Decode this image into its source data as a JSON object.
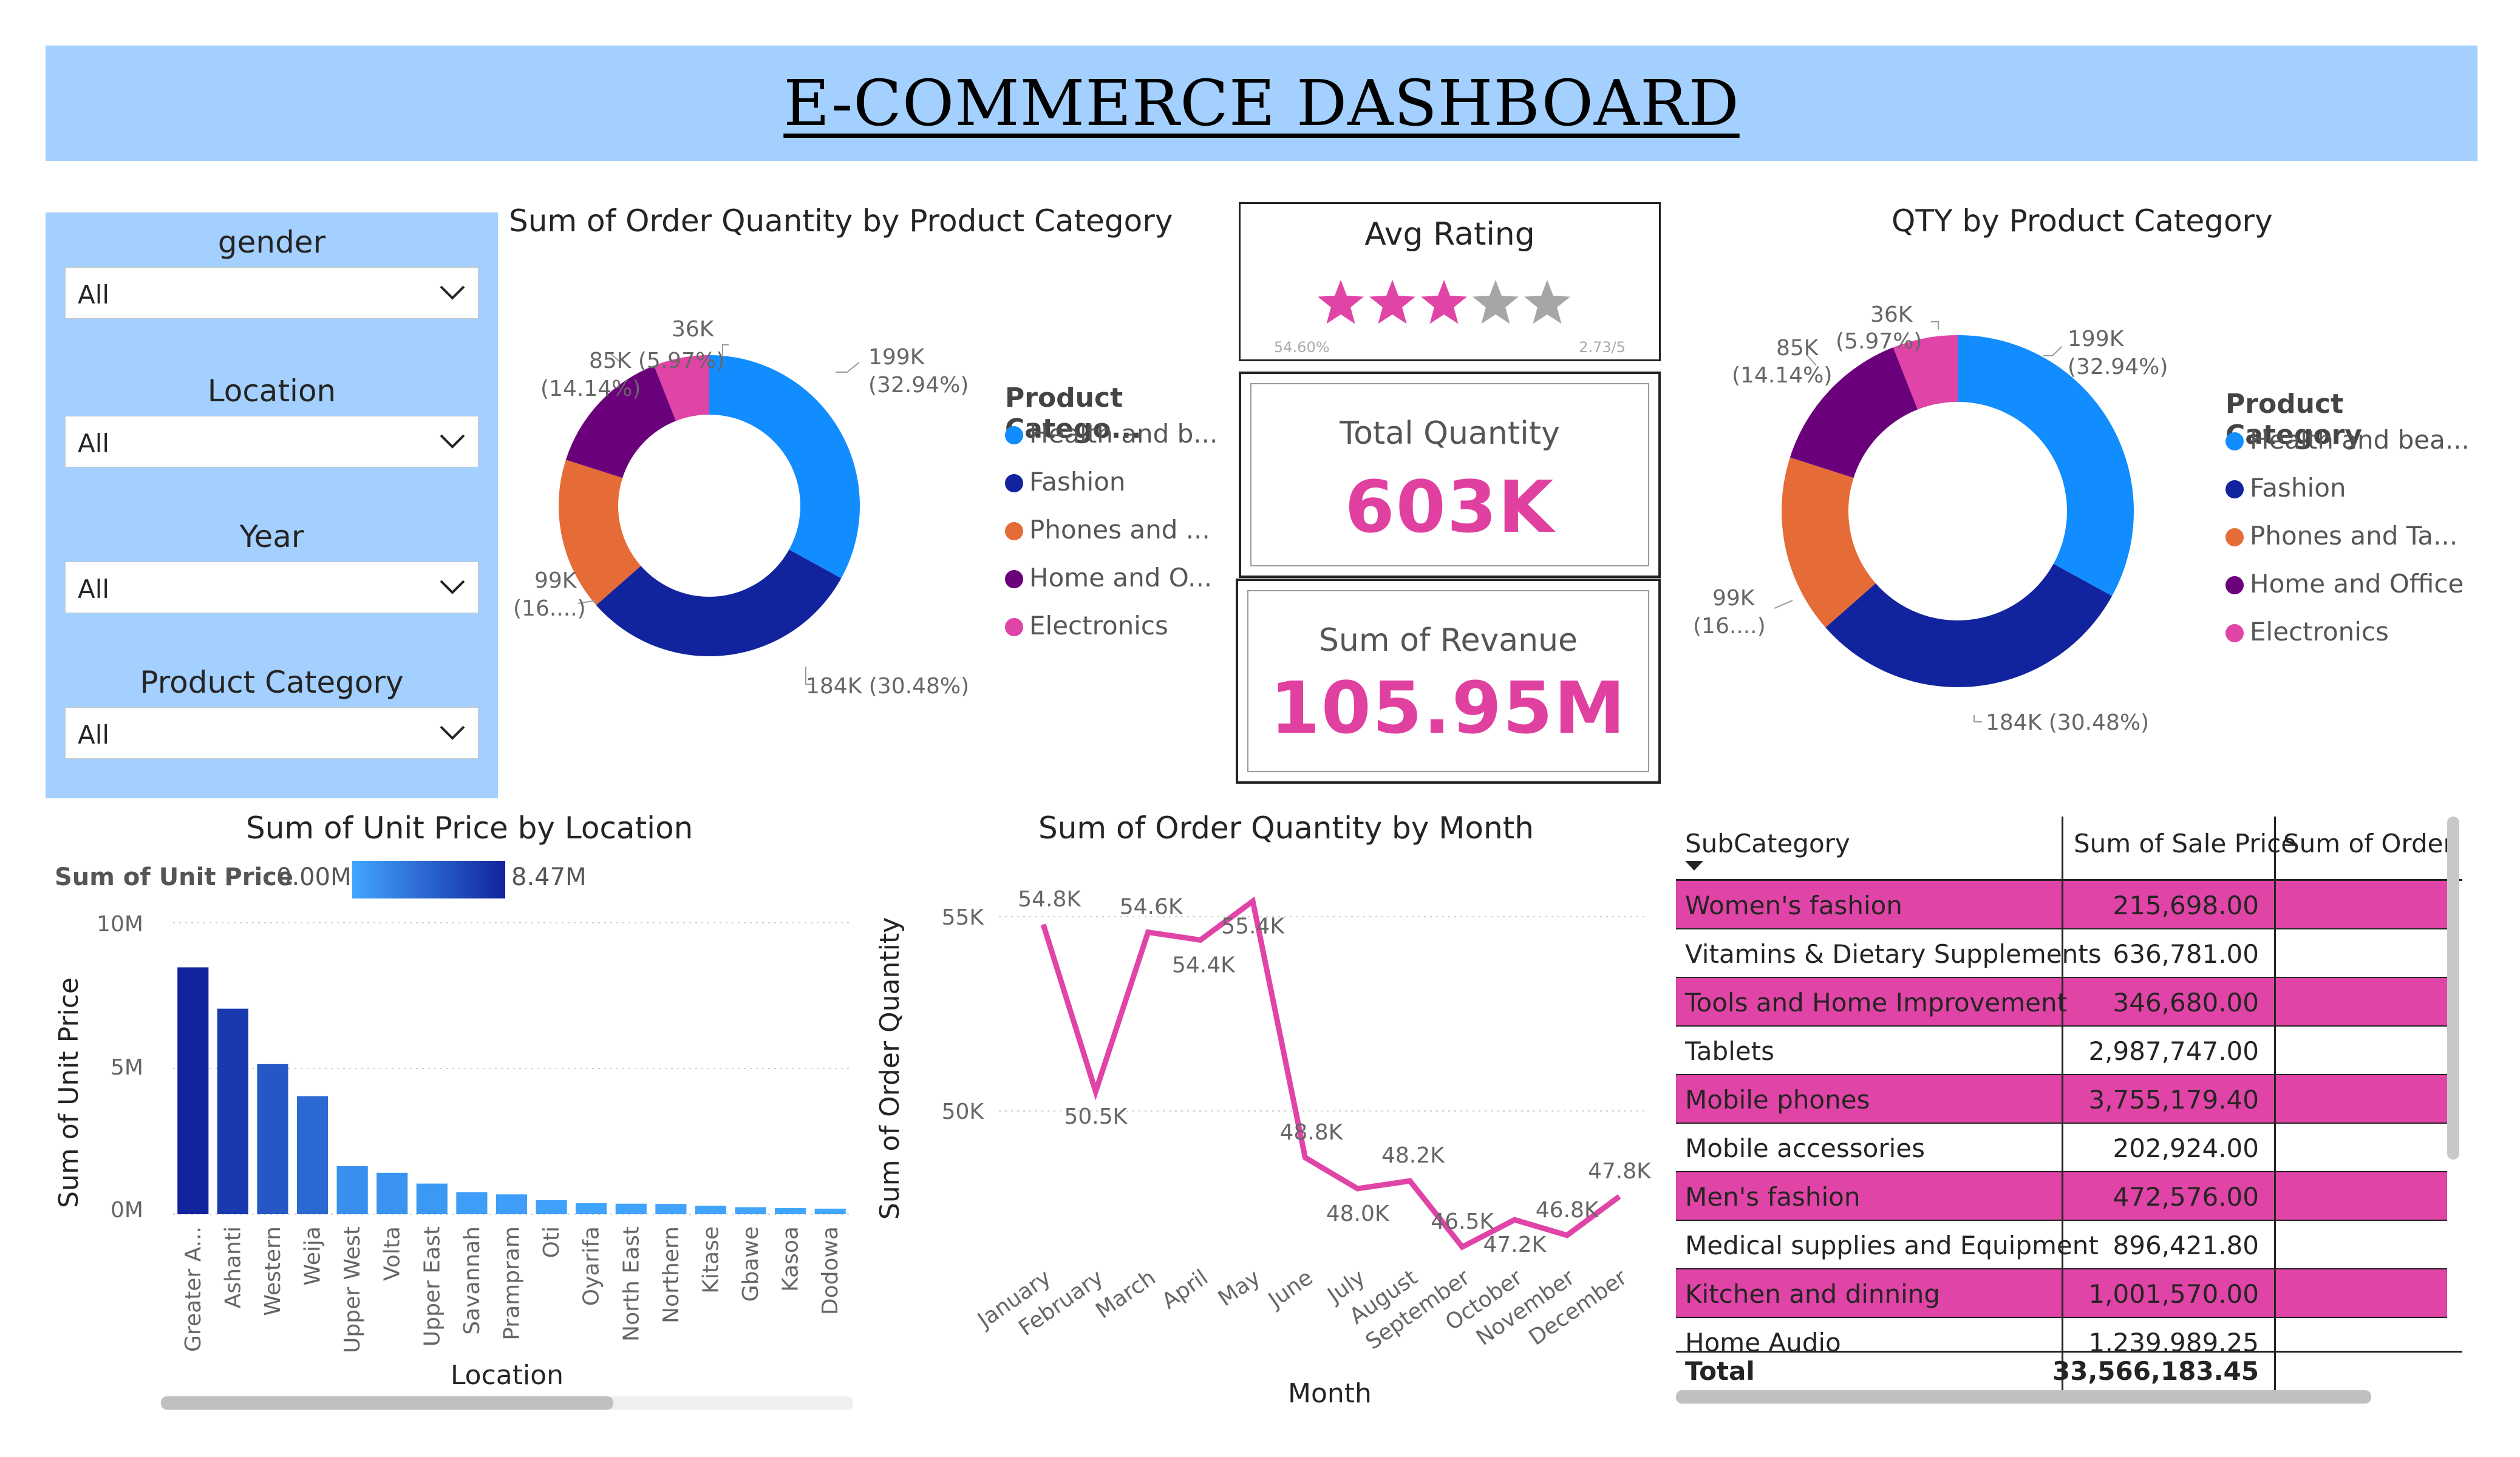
{
  "header": {
    "title": "E-COMMERCE DASHBOARD"
  },
  "filters": [
    {
      "label": "gender",
      "value": "All"
    },
    {
      "label": "Location",
      "value": "All"
    },
    {
      "label": "Year",
      "value": "All"
    },
    {
      "label": "Product Category",
      "value": "All"
    }
  ],
  "donut1": {
    "title": "Sum of Order Quantity by Product Category",
    "legend_title": "Product Catego...",
    "legend_items": [
      "Health and b...",
      "Fashion",
      "Phones and ...",
      "Home and O...",
      "Electronics"
    ],
    "label_health_a": "199K",
    "label_health_b": "(32.94%)",
    "label_fashion": "184K (30.48%)",
    "label_phones_a": "99K",
    "label_phones_b": "(16....)",
    "label_home_a": "85K (5.97%)",
    "label_home_b": "(14.14%)",
    "label_elec": "36K"
  },
  "donut2": {
    "title": "QTY by Product Category",
    "legend_title": "Product Category",
    "legend_items": [
      "Health and bea...",
      "Fashion",
      "Phones and Ta...",
      "Home and Office",
      "Electronics"
    ],
    "label_health_a": "199K",
    "label_health_b": "(32.94%)",
    "label_fashion": "184K (30.48%)",
    "label_phones_a": "99K",
    "label_phones_b": "(16....)",
    "label_home_a": "85K",
    "label_home_b": "(14.14%)",
    "label_elec_a": "36K",
    "label_elec_b": "(5.97%)"
  },
  "categories_colors": {
    "Health": "#118dff",
    "Fashion": "#12239e",
    "Phones": "#e66c37",
    "Home": "#6b007b",
    "Electronics": "#e044a7"
  },
  "rating": {
    "title": "Avg Rating",
    "stars_filled": 3,
    "stars_total": 5,
    "left_small": "54.60%",
    "right_small": "2.73/5"
  },
  "total_quantity": {
    "label": "Total Quantity",
    "value": "603K"
  },
  "revenue": {
    "label": "Sum of Revanue",
    "value": "105.95M"
  },
  "location_chart": {
    "title": "Sum of Unit Price by Location",
    "legend_label": "Sum of Unit Price",
    "legend_min": "0.00M",
    "legend_max": "8.47M",
    "xlabel": "Location",
    "ylabel": "Sum of Unit Price",
    "yticks": [
      "10M",
      "5M",
      "0M"
    ]
  },
  "month_chart": {
    "title": "Sum of Order Quantity by Month",
    "xlabel": "Month",
    "ylabel": "Sum of Order Quantity",
    "yticks": [
      "55K",
      "50K"
    ]
  },
  "table": {
    "headers": [
      "SubCategory",
      "Sum of Sale Price",
      "Sum of Order C"
    ],
    "rows": [
      {
        "name": "Women's fashion",
        "price": "215,698.00",
        "highlight": true
      },
      {
        "name": "Vitamins & Dietary Supplements",
        "price": "636,781.00",
        "highlight": false
      },
      {
        "name": "Tools and Home Improvement",
        "price": "346,680.00",
        "highlight": true
      },
      {
        "name": "Tablets",
        "price": "2,987,747.00",
        "highlight": false
      },
      {
        "name": "Mobile phones",
        "price": "3,755,179.40",
        "highlight": true
      },
      {
        "name": "Mobile accessories",
        "price": "202,924.00",
        "highlight": false
      },
      {
        "name": "Men's fashion",
        "price": "472,576.00",
        "highlight": true
      },
      {
        "name": "Medical supplies and Equipment",
        "price": "896,421.80",
        "highlight": false
      },
      {
        "name": "Kitchen and dinning",
        "price": "1,001,570.00",
        "highlight": true
      },
      {
        "name": "Home Audio",
        "price": "1,239,989.25",
        "highlight": false
      }
    ],
    "total_label": "Total",
    "total_value": "33,566,183.45"
  },
  "chart_data": [
    {
      "type": "pie",
      "title": "Sum of Order Quantity by Product Category",
      "categories": [
        "Health and b...",
        "Fashion",
        "Phones and ...",
        "Home and O...",
        "Electronics"
      ],
      "values": [
        199,
        184,
        99,
        85,
        36
      ],
      "unit": "K",
      "percent": [
        32.94,
        30.48,
        16.47,
        14.14,
        5.97
      ],
      "colors": [
        "#118dff",
        "#12239e",
        "#e66c37",
        "#6b007b",
        "#e044a7"
      ],
      "legend": "right"
    },
    {
      "type": "pie",
      "title": "QTY by Product Category",
      "categories": [
        "Health and bea...",
        "Fashion",
        "Phones and Ta...",
        "Home and Office",
        "Electronics"
      ],
      "values": [
        199,
        184,
        99,
        85,
        36
      ],
      "unit": "K",
      "percent": [
        32.94,
        30.48,
        16.47,
        14.14,
        5.97
      ],
      "colors": [
        "#118dff",
        "#12239e",
        "#e66c37",
        "#6b007b",
        "#e044a7"
      ],
      "legend": "right"
    },
    {
      "type": "bar",
      "title": "Sum of Unit Price by Location",
      "xlabel": "Location",
      "ylabel": "Sum of Unit Price",
      "categories": [
        "Greater A...",
        "Ashanti",
        "Western",
        "Weija",
        "Upper West",
        "Volta",
        "Upper East",
        "Savannah",
        "Prampram",
        "Oti",
        "Oyarifa",
        "North East",
        "Northern",
        "Kitase",
        "Gbawe",
        "Kasoa",
        "Dodowa"
      ],
      "values": [
        8.47,
        7.05,
        5.15,
        4.05,
        1.65,
        1.42,
        1.05,
        0.75,
        0.68,
        0.48,
        0.38,
        0.36,
        0.35,
        0.29,
        0.24,
        0.21,
        0.19
      ],
      "unit": "M",
      "ylim": [
        0,
        10
      ],
      "grid": true
    },
    {
      "type": "line",
      "title": "Sum of Order Quantity by Month",
      "xlabel": "Month",
      "ylabel": "Sum of Order Quantity",
      "x": [
        "January",
        "February",
        "March",
        "April",
        "May",
        "June",
        "July",
        "August",
        "September",
        "October",
        "November",
        "December"
      ],
      "values": [
        54.8,
        50.5,
        54.6,
        54.4,
        55.4,
        48.8,
        48.0,
        48.2,
        46.5,
        47.2,
        46.8,
        47.8
      ],
      "labels": [
        "54.8K",
        "50.5K",
        "54.6K",
        "54.4K",
        "55.4K",
        "48.8K",
        "48.0K",
        "48.2K",
        "46.5K",
        "47.2K",
        "46.8K",
        "47.8K"
      ],
      "unit": "K",
      "ylim": [
        45.5,
        56.5
      ],
      "color": "#e044a7",
      "grid": true
    }
  ]
}
